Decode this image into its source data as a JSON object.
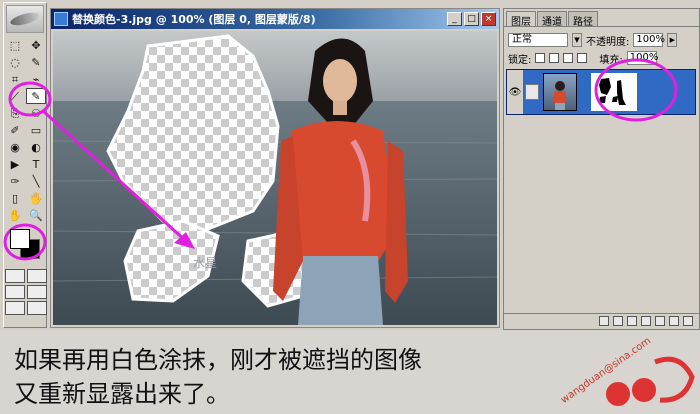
{
  "window": {
    "title": "替换颜色-3.jpg @ 100% (图层 0, 图层蒙版/8)",
    "minimize_glyph": "_",
    "maximize_glyph": "□",
    "close_glyph": "×"
  },
  "toolbox": {
    "tools": [
      "⬚",
      "✥",
      "◌",
      "✎",
      "⌗",
      "⌁",
      "⟋",
      "✎",
      "⎘",
      "⚇",
      "✐",
      "▭",
      "◉",
      "◐",
      "▶",
      "T",
      "✑",
      "╲",
      "▯",
      "🖐",
      "✋",
      "🔍"
    ],
    "foreground_color": "#ffffff",
    "background_color": "#000000"
  },
  "layers_panel": {
    "tabs": [
      "图层",
      "通道",
      "路径"
    ],
    "blend_mode": "正常",
    "opacity_label": "不透明度:",
    "opacity_value": "100%",
    "lock_label": "锁定:",
    "fill_label": "填充:",
    "fill_value": "100%"
  },
  "caption": {
    "line1": "如果再用白色涂抹，刚才被遮挡的图像",
    "line2": "又重新显露出来了。"
  },
  "watermark": {
    "text": "wangduan@sina.com"
  },
  "colors": {
    "highlight": "#e020e0",
    "title_bar": "#0a246a",
    "selected_layer": "#316ac5"
  }
}
